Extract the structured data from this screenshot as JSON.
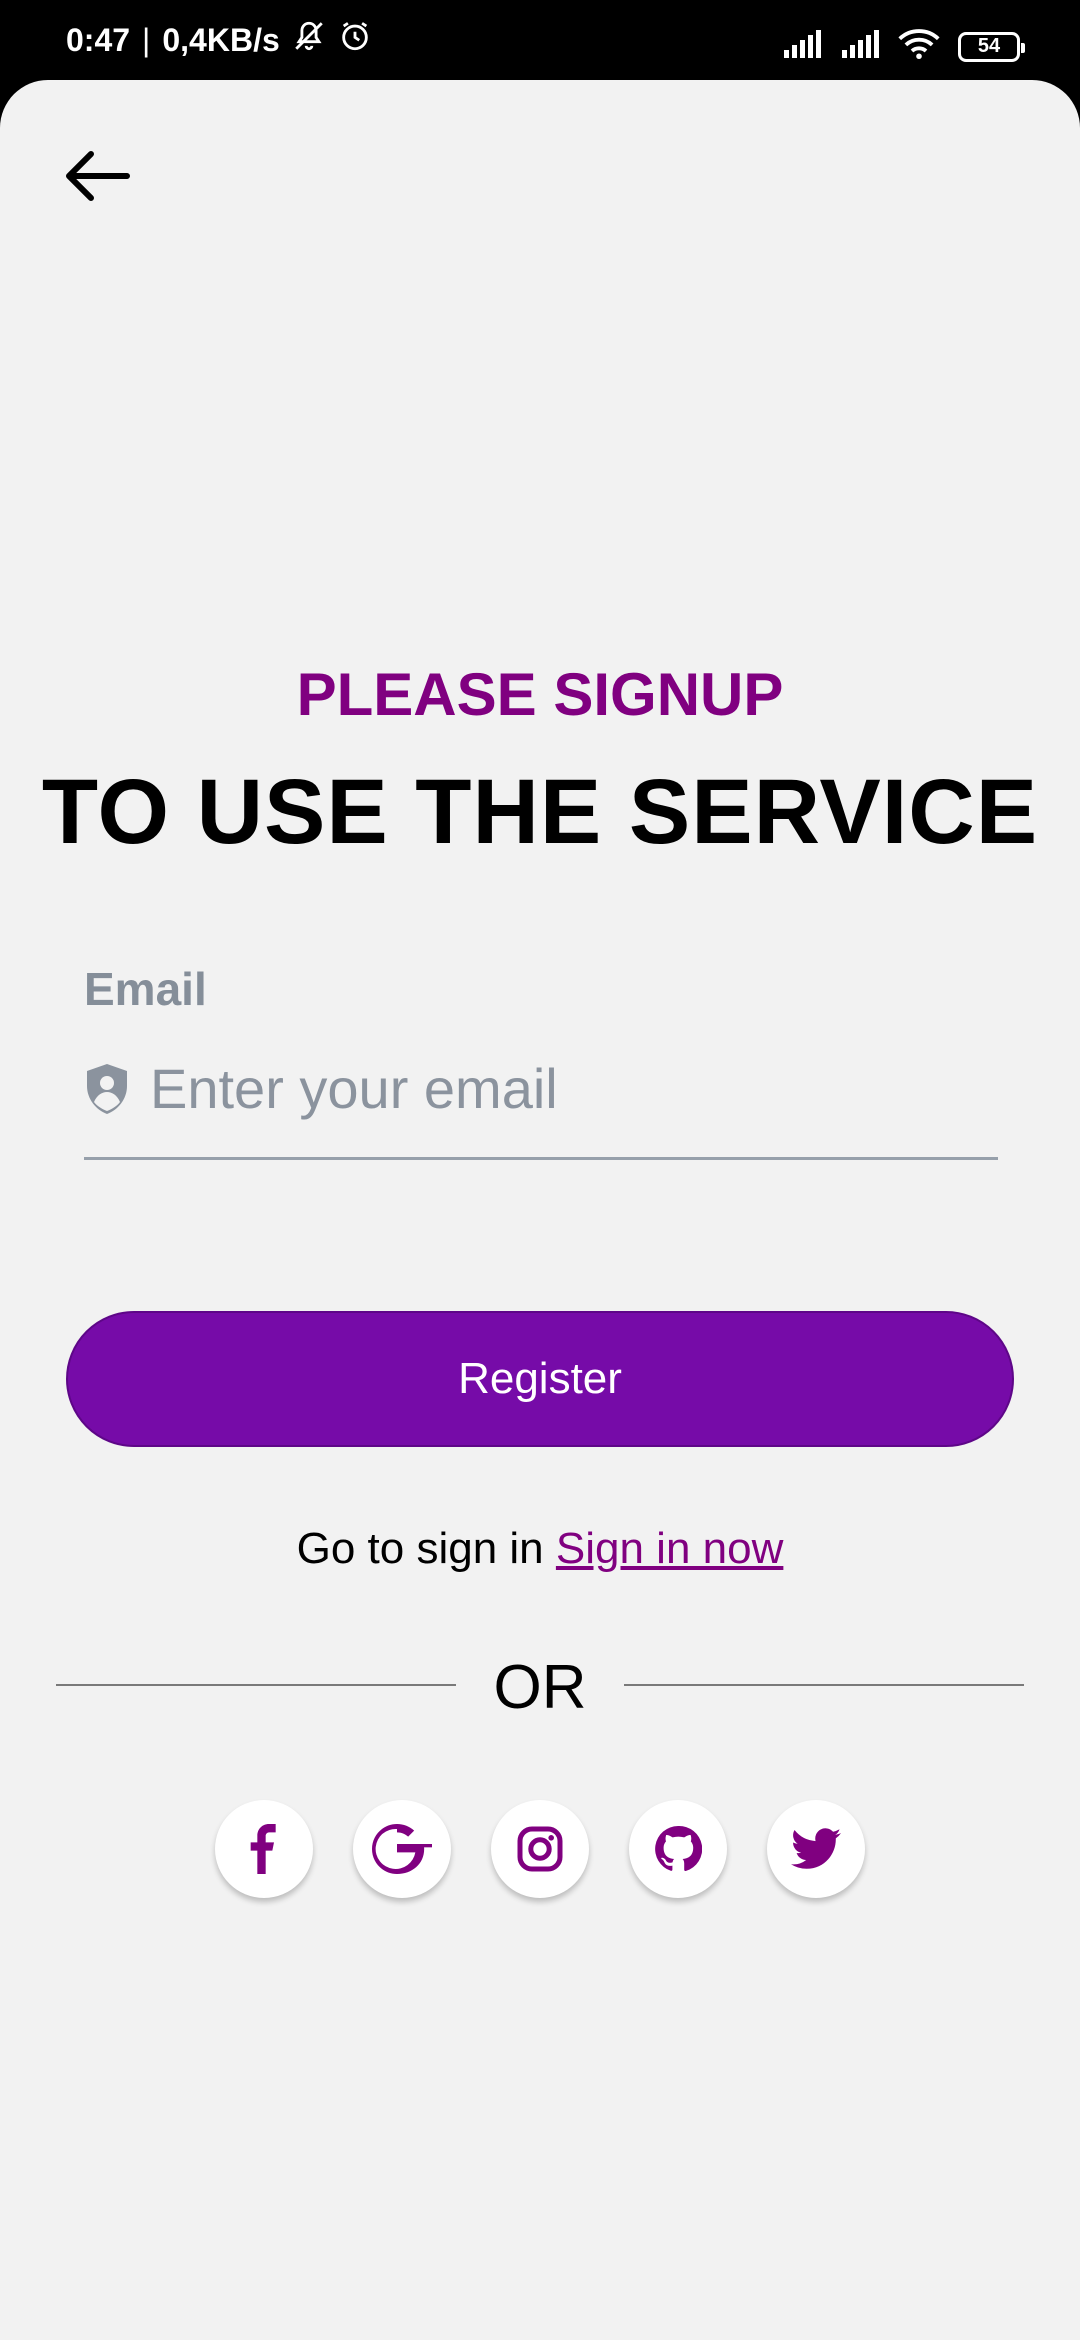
{
  "status_bar": {
    "time": "0:47",
    "separator": "|",
    "network_speed": "0,4KB/s",
    "battery": "54",
    "icons": [
      "mute-icon",
      "alarm-icon",
      "signal-icon",
      "signal-icon",
      "wifi-icon",
      "battery-icon"
    ]
  },
  "header": {
    "back_icon": "arrow-left-icon"
  },
  "hero": {
    "subtitle": "PLEASE SIGNUP",
    "title": "TO USE THE SERVICE"
  },
  "form": {
    "email_label": "Email",
    "email_placeholder": "Enter your email",
    "email_value": "",
    "email_icon": "shield-user-icon",
    "register_label": "Register"
  },
  "signin": {
    "prompt": "Go to sign in",
    "link": "Sign in now"
  },
  "divider": {
    "text": "OR"
  },
  "social": [
    {
      "name": "facebook",
      "icon": "facebook-icon"
    },
    {
      "name": "google",
      "icon": "google-icon"
    },
    {
      "name": "instagram",
      "icon": "instagram-icon"
    },
    {
      "name": "github",
      "icon": "github-icon"
    },
    {
      "name": "twitter",
      "icon": "twitter-icon"
    }
  ],
  "colors": {
    "accent": "#800080",
    "button": "#760ba8",
    "background": "#f2f2f2",
    "muted": "#858e99"
  }
}
